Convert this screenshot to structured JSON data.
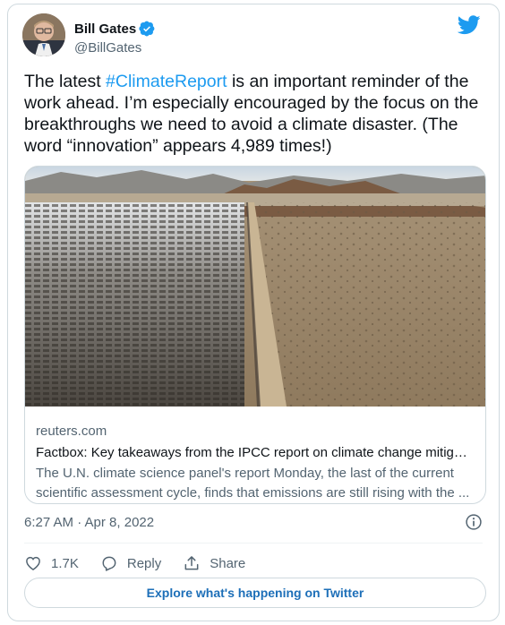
{
  "author": {
    "name": "Bill Gates",
    "handle": "@BillGates"
  },
  "tweet": {
    "text_before": "The latest ",
    "hashtag": "#ClimateReport",
    "text_after": " is an important reminder of the work ahead. I’m especially encouraged by the focus on the breakthroughs we need to avoid a climate disaster. (The word “innovation” appears 4,989 times!)"
  },
  "link_card": {
    "domain": "reuters.com",
    "title": "Factbox: Key takeaways from the IPCC report on climate change mitigati...",
    "description": "The U.N. climate science panel's report Monday, the last of the current scientific assessment cycle, finds that emissions are still rising with the ..."
  },
  "meta": {
    "timestamp": "6:27 AM · Apr 8, 2022"
  },
  "actions": {
    "like_count": "1.7K",
    "reply_label": "Reply",
    "share_label": "Share"
  },
  "explore_label": "Explore what's happening on Twitter",
  "colors": {
    "accent": "#1d9bf0",
    "text": "#0f1419",
    "muted": "#536471",
    "border": "#cfd9de"
  },
  "icons": [
    "verified-badge-icon",
    "twitter-bird-icon",
    "info-icon",
    "heart-icon",
    "reply-icon",
    "share-icon"
  ]
}
